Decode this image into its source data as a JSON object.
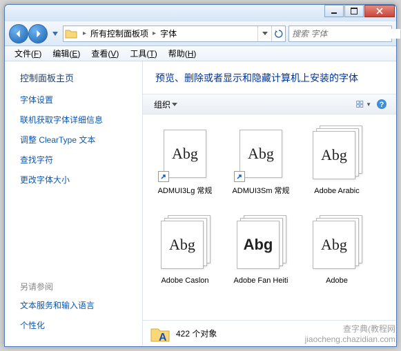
{
  "breadcrumb": {
    "item1": "所有控制面板项",
    "item2": "字体"
  },
  "search": {
    "placeholder": "搜索 字体"
  },
  "menubar": {
    "file": "文件(",
    "file_k": "F",
    "file2": ")",
    "edit": "编辑(",
    "edit_k": "E",
    "edit2": ")",
    "view": "查看(",
    "view_k": "V",
    "view2": ")",
    "tools": "工具(",
    "tools_k": "T",
    "tools2": ")",
    "help": "帮助(",
    "help_k": "H",
    "help2": ")"
  },
  "sidebar": {
    "head": "控制面板主页",
    "links": [
      "字体设置",
      "联机获取字体详细信息",
      "调整 ClearType 文本",
      "查找字符",
      "更改字体大小"
    ],
    "see_also_head": "另请参阅",
    "see_also": [
      "文本服务和输入语言",
      "个性化"
    ]
  },
  "main": {
    "heading": "预览、删除或者显示和隐藏计算机上安装的字体",
    "toolbar": {
      "organize": "组织"
    },
    "fonts": [
      {
        "label": "ADMUI3Lg 常规",
        "sample": "Abg",
        "shortcut": true,
        "stack": false
      },
      {
        "label": "ADMUI3Sm 常规",
        "sample": "Abg",
        "shortcut": true,
        "stack": false
      },
      {
        "label": "Adobe Arabic",
        "sample": "Abg",
        "shortcut": false,
        "stack": true
      },
      {
        "label": "Adobe Caslon",
        "sample": "Abg",
        "shortcut": false,
        "stack": true
      },
      {
        "label": "Adobe Fan Heiti",
        "sample": "Abg",
        "shortcut": false,
        "stack": true
      },
      {
        "label": "Adobe",
        "sample": "Abg",
        "shortcut": false,
        "stack": true
      }
    ],
    "status": "422 个对象"
  },
  "watermark": {
    "l1": "查字典(教程网",
    "l2": "jiaocheng.chazidian.com"
  }
}
